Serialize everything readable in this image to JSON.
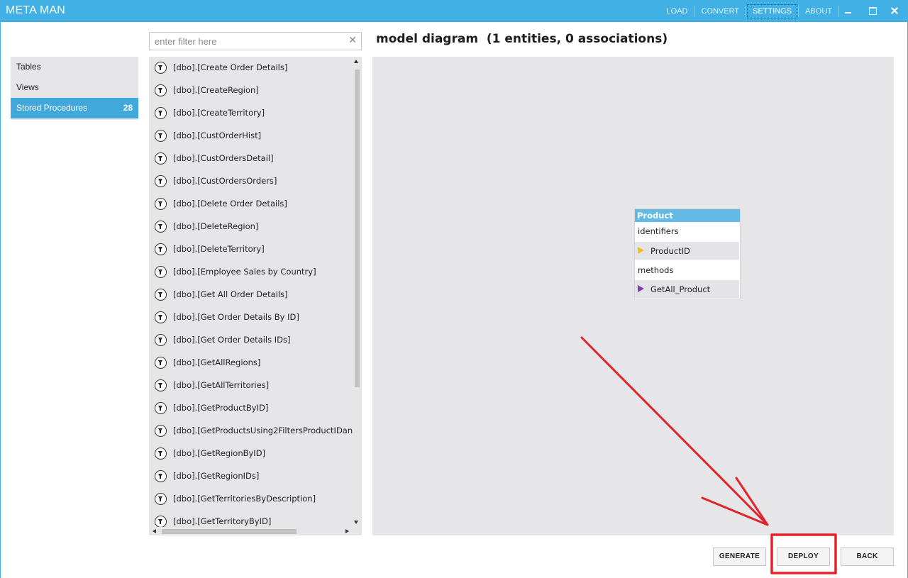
{
  "app": {
    "title": "META MAN"
  },
  "menu": {
    "items": [
      {
        "label": "LOAD"
      },
      {
        "label": "CONVERT"
      },
      {
        "label": "SETTINGS"
      },
      {
        "label": "ABOUT"
      }
    ]
  },
  "nav": {
    "items": [
      {
        "label": "Tables",
        "count": ""
      },
      {
        "label": "Views",
        "count": ""
      },
      {
        "label": "Stored Procedures",
        "count": "28"
      }
    ]
  },
  "filter": {
    "placeholder": "enter filter here",
    "value": ""
  },
  "procedures": [
    "[dbo].[Create Order Details]",
    "[dbo].[CreateRegion]",
    "[dbo].[CreateTerritory]",
    "[dbo].[CustOrderHist]",
    "[dbo].[CustOrdersDetail]",
    "[dbo].[CustOrdersOrders]",
    "[dbo].[Delete Order Details]",
    "[dbo].[DeleteRegion]",
    "[dbo].[DeleteTerritory]",
    "[dbo].[Employee Sales by Country]",
    "[dbo].[Get All Order Details]",
    "[dbo].[Get Order Details By ID]",
    "[dbo].[Get Order Details IDs]",
    "[dbo].[GetAllRegions]",
    "[dbo].[GetAllTerritories]",
    "[dbo].[GetProductByID]",
    "[dbo].[GetProductsUsing2FiltersProductIDand",
    "[dbo].[GetRegionByID]",
    "[dbo].[GetRegionIDs]",
    "[dbo].[GetTerritoriesByDescription]",
    "[dbo].[GetTerritoryByID]"
  ],
  "diagram": {
    "title": "model diagram  (1 entities, 0 associations)",
    "entity": {
      "name": "Product",
      "identifiers_label": "identifiers",
      "identifier": "ProductID",
      "methods_label": "methods",
      "method": "GetAll_Product"
    }
  },
  "buttons": {
    "generate": "GENERATE",
    "deploy": "DEPLOY",
    "back": "BACK"
  },
  "colors": {
    "titlebar": "#41b0e4",
    "nav_active": "#41a8dc",
    "entity_header": "#63b8e4",
    "annotation": "#e0242c",
    "identifier_marker": "#f0c020",
    "method_marker": "#7a3fa8"
  },
  "icons": {
    "procedure": "filter-circle-icon",
    "identifier": "key-triangle-icon",
    "method": "method-triangle-icon"
  }
}
